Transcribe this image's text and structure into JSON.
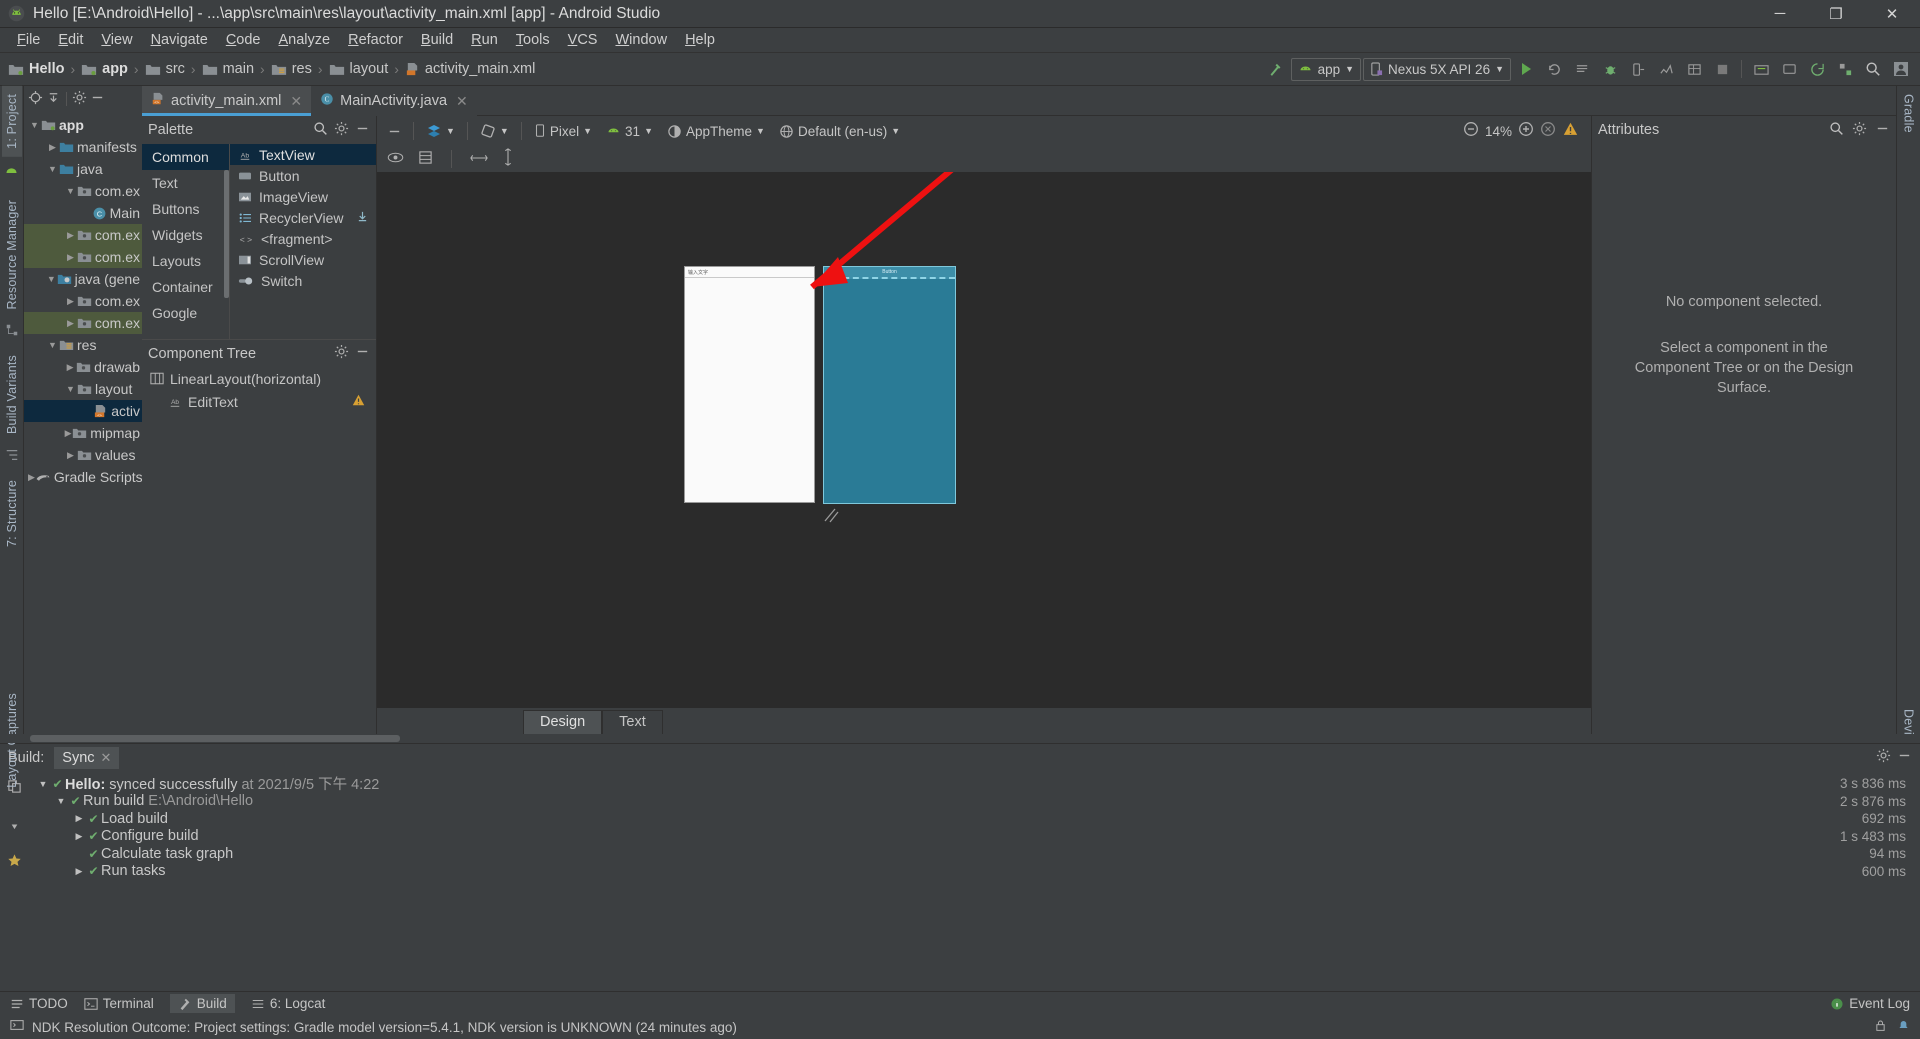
{
  "window": {
    "title": "Hello [E:\\Android\\Hello] - ...\\app\\src\\main\\res\\layout\\activity_main.xml [app] - Android Studio",
    "minimize": "─",
    "maximize": "❐",
    "close": "✕"
  },
  "menubar": {
    "items": [
      "File",
      "Edit",
      "View",
      "Navigate",
      "Code",
      "Analyze",
      "Refactor",
      "Build",
      "Run",
      "Tools",
      "VCS",
      "Window",
      "Help"
    ]
  },
  "breadcrumbs": [
    {
      "label": "Hello",
      "icon": "module-icon",
      "bold": true
    },
    {
      "label": "app",
      "icon": "module-icon",
      "bold": true
    },
    {
      "label": "src",
      "icon": "folder-icon",
      "bold": false
    },
    {
      "label": "main",
      "icon": "folder-icon",
      "bold": false
    },
    {
      "label": "res",
      "icon": "res-folder-icon",
      "bold": false
    },
    {
      "label": "layout",
      "icon": "folder-icon",
      "bold": false
    },
    {
      "label": "activity_main.xml",
      "icon": "xml-layout-icon",
      "bold": false
    }
  ],
  "toolbar": {
    "module_selector": "app",
    "device_selector": "Nexus 5X API 26",
    "run_icon": "run-icon",
    "apply_changes_icon": "apply-changes-icon",
    "debug_icon": "debug-icon",
    "search_icon": "search-icon"
  },
  "left_strips": [
    {
      "label": "1: Project",
      "active": true
    },
    {
      "label": "Resource Manager",
      "active": false
    },
    {
      "label": "Build Variants",
      "active": false
    },
    {
      "label": "7: Structure",
      "active": false
    },
    {
      "label": "Layout Captures",
      "active": false
    },
    {
      "label": "2: Favorites",
      "active": false
    }
  ],
  "right_strips": [
    {
      "label": "Gradle",
      "active": false
    },
    {
      "label": "Device File Explorer",
      "active": false
    }
  ],
  "project_tree": {
    "header_icons": [
      "locate-icon",
      "collapse-all-icon",
      "gear-icon",
      "hide-icon"
    ],
    "nodes": [
      {
        "label": "app",
        "depth": 0,
        "twisty": "▼",
        "icon": "module-icon",
        "bold": true,
        "state": "none"
      },
      {
        "label": "manifests",
        "depth": 1,
        "twisty": "▶",
        "icon": "folder-blue",
        "bold": false,
        "state": "none"
      },
      {
        "label": "java",
        "depth": 1,
        "twisty": "▼",
        "icon": "folder-blue",
        "bold": false,
        "state": "none"
      },
      {
        "label": "com.ex",
        "depth": 2,
        "twisty": "▼",
        "icon": "package-icon",
        "bold": false,
        "state": "none"
      },
      {
        "label": "Main",
        "depth": 3,
        "twisty": "",
        "icon": "class-icon",
        "bold": false,
        "state": "none"
      },
      {
        "label": "com.ex",
        "depth": 2,
        "twisty": "▶",
        "icon": "package-icon",
        "bold": false,
        "state": "mod"
      },
      {
        "label": "com.ex",
        "depth": 2,
        "twisty": "▶",
        "icon": "package-icon",
        "bold": false,
        "state": "mod"
      },
      {
        "label": "java (gene",
        "depth": 1,
        "twisty": "▼",
        "icon": "generated-folder",
        "bold": false,
        "state": "none"
      },
      {
        "label": "com.ex",
        "depth": 2,
        "twisty": "▶",
        "icon": "package-icon",
        "bold": false,
        "state": "none"
      },
      {
        "label": "com.ex",
        "depth": 2,
        "twisty": "▶",
        "icon": "package-icon",
        "bold": false,
        "state": "mod"
      },
      {
        "label": "res",
        "depth": 1,
        "twisty": "▼",
        "icon": "res-folder-icon",
        "bold": false,
        "state": "none"
      },
      {
        "label": "drawab",
        "depth": 2,
        "twisty": "▶",
        "icon": "package-icon",
        "bold": false,
        "state": "none"
      },
      {
        "label": "layout",
        "depth": 2,
        "twisty": "▼",
        "icon": "package-icon",
        "bold": false,
        "state": "none"
      },
      {
        "label": "activ",
        "depth": 3,
        "twisty": "",
        "icon": "xml-layout-icon",
        "bold": false,
        "state": "sel"
      },
      {
        "label": "mipmap",
        "depth": 2,
        "twisty": "▶",
        "icon": "package-icon",
        "bold": false,
        "state": "none"
      },
      {
        "label": "values",
        "depth": 2,
        "twisty": "▶",
        "icon": "package-icon",
        "bold": false,
        "state": "none"
      },
      {
        "label": "Gradle Scripts",
        "depth": 0,
        "twisty": "▶",
        "icon": "gradle-icon",
        "bold": false,
        "state": "none"
      }
    ]
  },
  "editor_tabs": [
    {
      "label": "activity_main.xml",
      "icon": "xml-layout-icon",
      "active": true
    },
    {
      "label": "MainActivity.java",
      "icon": "class-icon",
      "active": false
    }
  ],
  "palette": {
    "title": "Palette",
    "search_icon": "search-icon",
    "gear_icon": "gear-icon",
    "hide_icon": "hide-icon",
    "categories": [
      {
        "label": "Common",
        "active": true
      },
      {
        "label": "Text",
        "active": false
      },
      {
        "label": "Buttons",
        "active": false
      },
      {
        "label": "Widgets",
        "active": false
      },
      {
        "label": "Layouts",
        "active": false
      },
      {
        "label": "Container",
        "active": false
      },
      {
        "label": "Google",
        "active": false
      }
    ],
    "items": [
      {
        "label": "TextView",
        "icon": "textview-icon",
        "active": true,
        "download": false
      },
      {
        "label": "Button",
        "icon": "button-icon",
        "active": false,
        "download": false
      },
      {
        "label": "ImageView",
        "icon": "imageview-icon",
        "active": false,
        "download": false
      },
      {
        "label": "RecyclerView",
        "icon": "recyclerview-icon",
        "active": false,
        "download": true
      },
      {
        "label": "<fragment>",
        "icon": "fragment-icon",
        "active": false,
        "download": false
      },
      {
        "label": "ScrollView",
        "icon": "scrollview-icon",
        "active": false,
        "download": false
      },
      {
        "label": "Switch",
        "icon": "switch-icon",
        "active": false,
        "download": false
      }
    ]
  },
  "component_tree": {
    "title": "Component Tree",
    "gear_icon": "gear-icon",
    "hide_icon": "hide-icon",
    "nodes": [
      {
        "label": "LinearLayout(horizontal)",
        "icon": "linearlayout-icon",
        "indent": false,
        "warning": false
      },
      {
        "label": "EditText",
        "icon": "textview-icon",
        "indent": true,
        "warning": true
      }
    ]
  },
  "design_toolbar": {
    "eye_icon": "preview-eye-icon",
    "blueprint_icon": "blueprint-icon",
    "hide_icon": "hide-icon",
    "layers_label": "",
    "orientation_label": "",
    "device": "Pixel",
    "api_level": "31",
    "theme": "AppTheme",
    "locale": "Default (en-us)",
    "zoom_out_icon": "zoom-out-icon",
    "zoom_level": "14%",
    "zoom_in_icon": "zoom-in-icon",
    "zoom_fit_icon": "zoom-fit-icon",
    "warning_icon": "warning-icon",
    "sub_icons": [
      "eye-icon",
      "constraint-icon",
      "hmargin-icon",
      "vmargin-icon"
    ]
  },
  "canvas": {
    "edittext_hint": "输入文字",
    "button_label": "Button",
    "resize_handle": "resize-handle-icon"
  },
  "design_tabs": [
    {
      "label": "Design",
      "active": true
    },
    {
      "label": "Text",
      "active": false
    }
  ],
  "attributes": {
    "title": "Attributes",
    "search_icon": "search-icon",
    "gear_icon": "gear-icon",
    "hide_icon": "hide-icon",
    "empty_title": "No component selected.",
    "empty_body": "Select a component in the Component Tree or on the Design Surface."
  },
  "build": {
    "label": "Build:",
    "tab": "Sync",
    "tab_close": "✕",
    "gear_icon": "gear-icon",
    "hide_icon": "hide-icon",
    "side_icons": [
      "restart-icon",
      "pin-icon",
      "filter-icon"
    ],
    "rows": [
      {
        "twisty": "▼",
        "check": true,
        "indent": 0,
        "bold_text": "Hello:",
        "text": " synced successfully",
        "suffix": " at 2021/9/5 下午 4:22",
        "time": "3 s 836 ms"
      },
      {
        "twisty": "▼",
        "check": true,
        "indent": 1,
        "bold_text": "",
        "text": "Run build ",
        "suffix": "E:\\Android\\Hello",
        "time": "2 s 876 ms"
      },
      {
        "twisty": "▶",
        "check": true,
        "indent": 2,
        "bold_text": "",
        "text": "Load build",
        "suffix": "",
        "time": "692 ms"
      },
      {
        "twisty": "▶",
        "check": true,
        "indent": 2,
        "bold_text": "",
        "text": "Configure build",
        "suffix": "",
        "time": "1 s 483 ms"
      },
      {
        "twisty": "",
        "check": true,
        "indent": 2,
        "bold_text": "",
        "text": "Calculate task graph",
        "suffix": "",
        "time": "94 ms"
      },
      {
        "twisty": "▶",
        "check": true,
        "indent": 2,
        "bold_text": "",
        "text": "Run tasks",
        "suffix": "",
        "time": "600 ms"
      }
    ]
  },
  "bottom_bar": {
    "items": [
      {
        "label": "TODO",
        "icon": "todo-icon"
      },
      {
        "label": "Terminal",
        "icon": "terminal-icon"
      },
      {
        "label": "Build",
        "icon": "build-hammer-icon"
      },
      {
        "label": "6: Logcat",
        "icon": "logcat-icon"
      }
    ],
    "event_log": "Event Log",
    "event_log_icon": "info-icon"
  },
  "status_bar": {
    "icon": "console-icon",
    "text": "NDK Resolution Outcome: Project settings: Gradle model version=5.4.1, NDK version is UNKNOWN (24 minutes ago)",
    "lock_icon": "lock-icon",
    "notify_icon": "notify-icon"
  },
  "colors": {
    "bg": "#3c3f41",
    "canvas_bg": "#2b2b2b",
    "accent_blue": "#4a9fd4",
    "selection": "#0d293e",
    "modified_green": "#4e5a3d",
    "annotation_red": "#ee1111",
    "blueprint": "#2a7b96"
  }
}
